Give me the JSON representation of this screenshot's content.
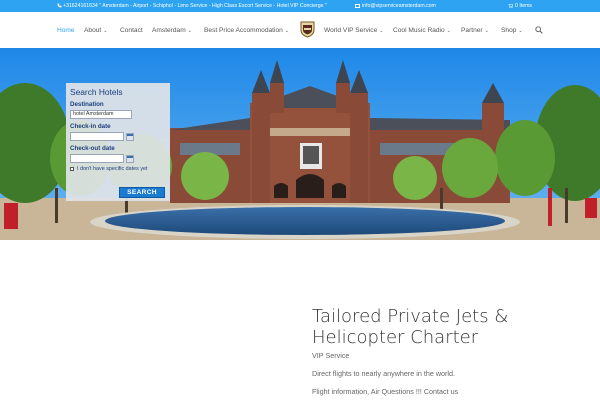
{
  "topbar": {
    "phone_text": "+31624161634 \" Amsterdam - Airport - Schiphol - Limo Service - High Class Escort Service - Hotel VIP Concierge \"",
    "email_text": "info@vipserviceamsterdam.com",
    "cart_text": "0 Items",
    "bg_color": "#2ea3f2"
  },
  "nav": {
    "items": [
      {
        "label": "Home",
        "active": true
      },
      {
        "label": "About",
        "dropdown": true
      },
      {
        "label": "Contact"
      },
      {
        "label": "Amsterdam",
        "dropdown": true
      },
      {
        "label": "Best Price Accommodation",
        "dropdown": true
      },
      {
        "label": "World VIP Service",
        "dropdown": true
      },
      {
        "label": "Cool Music Radio",
        "dropdown": true
      },
      {
        "label": "Partner",
        "dropdown": true
      },
      {
        "label": "Shop",
        "dropdown": true
      }
    ],
    "chevron": "⌄",
    "accent_color": "#2ea3f2",
    "logo_icon": "vip-badge-icon",
    "search_icon": "search-icon"
  },
  "search_panel": {
    "title": "Search Hotels",
    "destination_label": "Destination",
    "destination_value": "hotel Amsterdam",
    "checkin_label": "Check-in date",
    "checkout_label": "Check-out date",
    "no_dates_label": "I don't have specific dates yet",
    "search_button": "SEARCH"
  },
  "content": {
    "title": "Tailored Private Jets & Helicopter Charter",
    "subtitle": "VIP Service",
    "paragraph1": "Direct flights to nearly anywhere in the world.",
    "paragraph2": "Flight information, Air Questions !!! Contact us"
  }
}
